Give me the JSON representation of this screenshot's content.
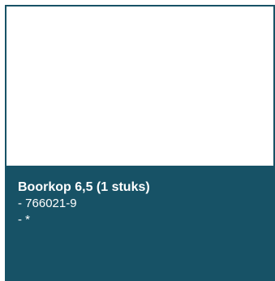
{
  "card": {
    "title": "Boorkop 6,5 (1 stuks)",
    "article_number": "- 766021-9",
    "extra": "- *"
  },
  "colors": {
    "card_background": "#175266",
    "image_background": "#ffffff",
    "text": "#ffffff"
  }
}
